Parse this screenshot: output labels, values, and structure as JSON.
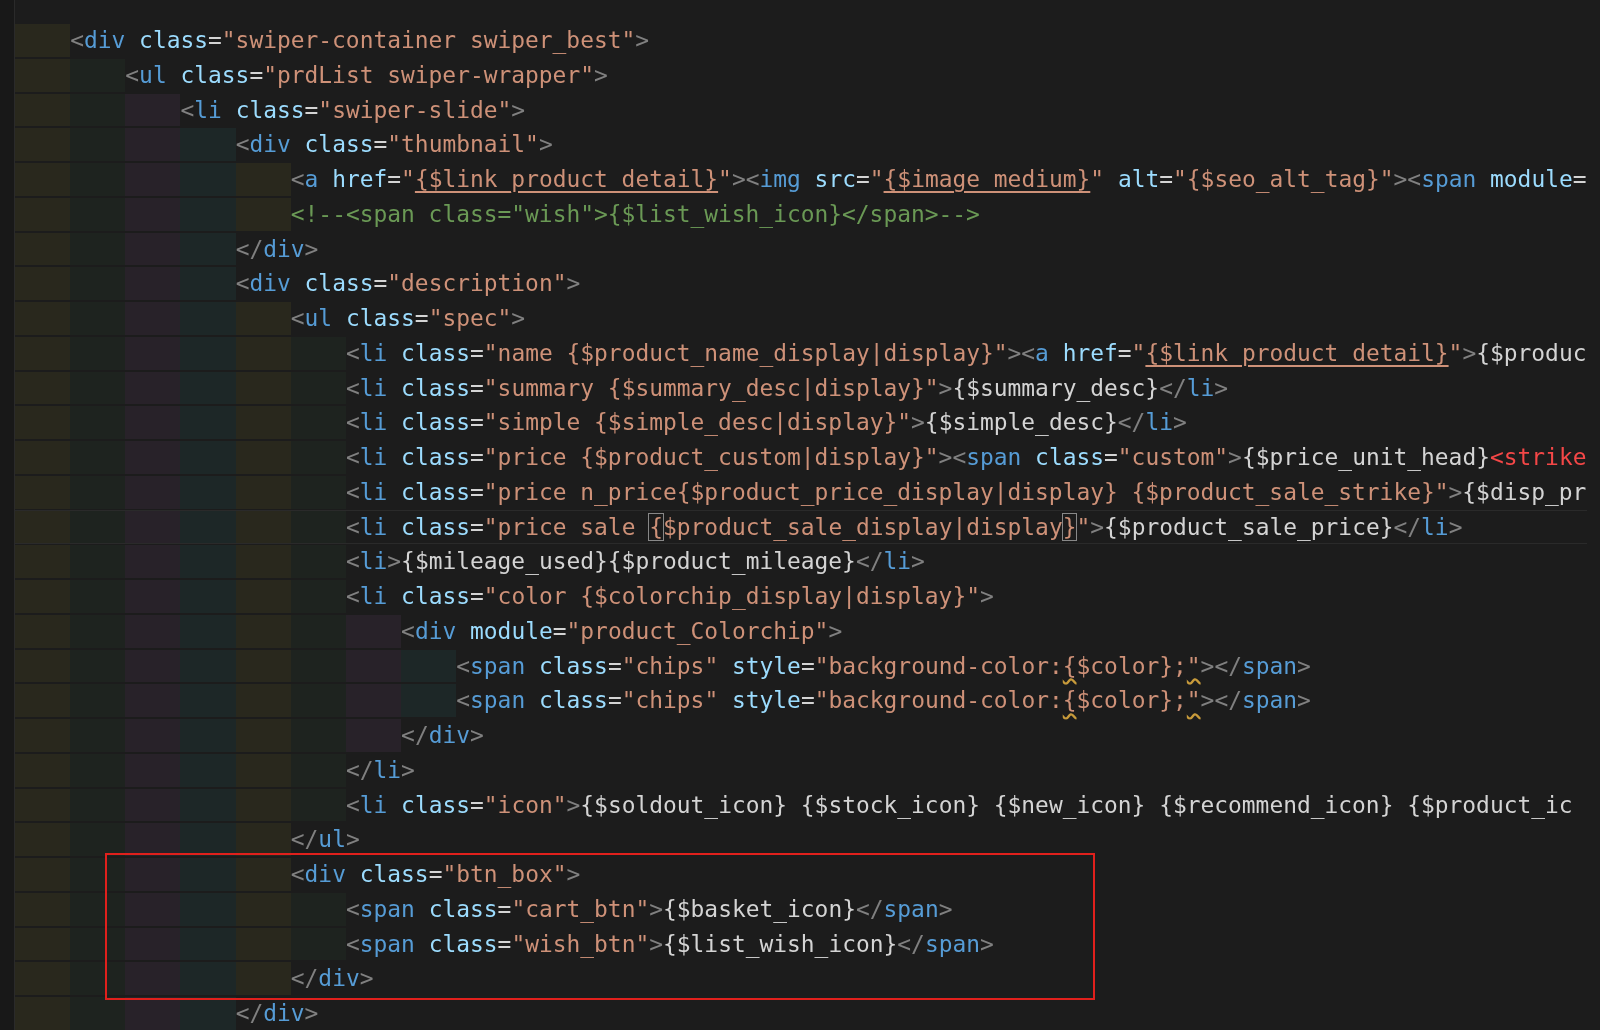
{
  "editor": {
    "lines": [
      {
        "boxed": false,
        "current": false,
        "tokens": [
          {
            "kind": "punct",
            "text": "    <"
          },
          {
            "kind": "tag",
            "text": "div"
          },
          {
            "kind": "attr",
            "text": " class"
          },
          {
            "kind": "text",
            "text": "="
          },
          {
            "kind": "string",
            "text": "\"swiper-container swiper_best\""
          },
          {
            "kind": "punct",
            "text": ">"
          }
        ]
      },
      {
        "boxed": false,
        "current": false,
        "tokens": [
          {
            "kind": "punct",
            "text": "        <"
          },
          {
            "kind": "tag",
            "text": "ul"
          },
          {
            "kind": "attr",
            "text": " class"
          },
          {
            "kind": "text",
            "text": "="
          },
          {
            "kind": "string",
            "text": "\"prdList swiper-wrapper\""
          },
          {
            "kind": "punct",
            "text": ">"
          }
        ]
      },
      {
        "boxed": false,
        "current": false,
        "tokens": [
          {
            "kind": "punct",
            "text": "            <"
          },
          {
            "kind": "tag",
            "text": "li"
          },
          {
            "kind": "attr",
            "text": " class"
          },
          {
            "kind": "text",
            "text": "="
          },
          {
            "kind": "string",
            "text": "\"swiper-slide\""
          },
          {
            "kind": "punct",
            "text": ">"
          }
        ]
      },
      {
        "boxed": false,
        "current": false,
        "tokens": [
          {
            "kind": "punct",
            "text": "                <"
          },
          {
            "kind": "tag",
            "text": "div"
          },
          {
            "kind": "attr",
            "text": " class"
          },
          {
            "kind": "text",
            "text": "="
          },
          {
            "kind": "string",
            "text": "\"thumbnail\""
          },
          {
            "kind": "punct",
            "text": ">"
          }
        ]
      },
      {
        "boxed": false,
        "current": false,
        "tokens": [
          {
            "kind": "punct",
            "text": "                    <"
          },
          {
            "kind": "tag",
            "text": "a"
          },
          {
            "kind": "attr",
            "text": " href"
          },
          {
            "kind": "text",
            "text": "="
          },
          {
            "kind": "string",
            "text": "\""
          },
          {
            "kind": "link",
            "text": "{$link_product_detail}"
          },
          {
            "kind": "string",
            "text": "\""
          },
          {
            "kind": "punct",
            "text": "><"
          },
          {
            "kind": "tag",
            "text": "img"
          },
          {
            "kind": "attr",
            "text": " src"
          },
          {
            "kind": "text",
            "text": "="
          },
          {
            "kind": "string",
            "text": "\""
          },
          {
            "kind": "link",
            "text": "{$image_medium}"
          },
          {
            "kind": "string",
            "text": "\""
          },
          {
            "kind": "attr",
            "text": " alt"
          },
          {
            "kind": "text",
            "text": "="
          },
          {
            "kind": "string",
            "text": "\"{$seo_alt_tag}\""
          },
          {
            "kind": "punct",
            "text": "><"
          },
          {
            "kind": "tag",
            "text": "span"
          },
          {
            "kind": "attr",
            "text": " module"
          },
          {
            "kind": "text",
            "text": "="
          }
        ]
      },
      {
        "boxed": false,
        "current": false,
        "tokens": [
          {
            "kind": "comment",
            "text": "                    <!--<span class=\"wish\">{$list_wish_icon}</span>-->"
          }
        ]
      },
      {
        "boxed": false,
        "current": false,
        "tokens": [
          {
            "kind": "punct",
            "text": "                </"
          },
          {
            "kind": "tag",
            "text": "div"
          },
          {
            "kind": "punct",
            "text": ">"
          }
        ]
      },
      {
        "boxed": false,
        "current": false,
        "tokens": [
          {
            "kind": "punct",
            "text": "                <"
          },
          {
            "kind": "tag",
            "text": "div"
          },
          {
            "kind": "attr",
            "text": " class"
          },
          {
            "kind": "text",
            "text": "="
          },
          {
            "kind": "string",
            "text": "\"description\""
          },
          {
            "kind": "punct",
            "text": ">"
          }
        ]
      },
      {
        "boxed": false,
        "current": false,
        "tokens": [
          {
            "kind": "punct",
            "text": "                    <"
          },
          {
            "kind": "tag",
            "text": "ul"
          },
          {
            "kind": "attr",
            "text": " class"
          },
          {
            "kind": "text",
            "text": "="
          },
          {
            "kind": "string",
            "text": "\"spec\""
          },
          {
            "kind": "punct",
            "text": ">"
          }
        ]
      },
      {
        "boxed": false,
        "current": false,
        "tokens": [
          {
            "kind": "punct",
            "text": "                        <"
          },
          {
            "kind": "tag",
            "text": "li"
          },
          {
            "kind": "attr",
            "text": " class"
          },
          {
            "kind": "text",
            "text": "="
          },
          {
            "kind": "string",
            "text": "\"name {$product_name_display|display}\""
          },
          {
            "kind": "punct",
            "text": "><"
          },
          {
            "kind": "tag",
            "text": "a"
          },
          {
            "kind": "attr",
            "text": " href"
          },
          {
            "kind": "text",
            "text": "="
          },
          {
            "kind": "string",
            "text": "\""
          },
          {
            "kind": "link",
            "text": "{$link_product_detail}"
          },
          {
            "kind": "string",
            "text": "\""
          },
          {
            "kind": "punct",
            "text": ">"
          },
          {
            "kind": "text",
            "text": "{$produc"
          }
        ]
      },
      {
        "boxed": false,
        "current": false,
        "tokens": [
          {
            "kind": "punct",
            "text": "                        <"
          },
          {
            "kind": "tag",
            "text": "li"
          },
          {
            "kind": "attr",
            "text": " class"
          },
          {
            "kind": "text",
            "text": "="
          },
          {
            "kind": "string",
            "text": "\"summary {$summary_desc|display}\""
          },
          {
            "kind": "punct",
            "text": ">"
          },
          {
            "kind": "text",
            "text": "{$summary_desc}"
          },
          {
            "kind": "punct",
            "text": "</"
          },
          {
            "kind": "tag",
            "text": "li"
          },
          {
            "kind": "punct",
            "text": ">"
          }
        ]
      },
      {
        "boxed": false,
        "current": false,
        "tokens": [
          {
            "kind": "punct",
            "text": "                        <"
          },
          {
            "kind": "tag",
            "text": "li"
          },
          {
            "kind": "attr",
            "text": " class"
          },
          {
            "kind": "text",
            "text": "="
          },
          {
            "kind": "string",
            "text": "\"simple {$simple_desc|display}\""
          },
          {
            "kind": "punct",
            "text": ">"
          },
          {
            "kind": "text",
            "text": "{$simple_desc}"
          },
          {
            "kind": "punct",
            "text": "</"
          },
          {
            "kind": "tag",
            "text": "li"
          },
          {
            "kind": "punct",
            "text": ">"
          }
        ]
      },
      {
        "boxed": false,
        "current": false,
        "tokens": [
          {
            "kind": "punct",
            "text": "                        <"
          },
          {
            "kind": "tag",
            "text": "li"
          },
          {
            "kind": "attr",
            "text": " class"
          },
          {
            "kind": "text",
            "text": "="
          },
          {
            "kind": "string",
            "text": "\"price {$product_custom|display}\""
          },
          {
            "kind": "punct",
            "text": "><"
          },
          {
            "kind": "tag",
            "text": "span"
          },
          {
            "kind": "attr",
            "text": " class"
          },
          {
            "kind": "text",
            "text": "="
          },
          {
            "kind": "string",
            "text": "\"custom\""
          },
          {
            "kind": "punct",
            "text": ">"
          },
          {
            "kind": "text",
            "text": "{$price_unit_head}"
          },
          {
            "kind": "deprecated",
            "text": "<strike"
          }
        ]
      },
      {
        "boxed": false,
        "current": false,
        "tokens": [
          {
            "kind": "punct",
            "text": "                        <"
          },
          {
            "kind": "tag",
            "text": "li"
          },
          {
            "kind": "attr",
            "text": " class"
          },
          {
            "kind": "text",
            "text": "="
          },
          {
            "kind": "string",
            "text": "\"price n_price{$product_price_display|display} {$product_sale_strike}\""
          },
          {
            "kind": "punct",
            "text": ">"
          },
          {
            "kind": "text",
            "text": "{$disp_pr"
          }
        ]
      },
      {
        "boxed": false,
        "current": true,
        "tokens": [
          {
            "kind": "punct",
            "text": "                        <"
          },
          {
            "kind": "tag",
            "text": "li"
          },
          {
            "kind": "attr",
            "text": " class"
          },
          {
            "kind": "text",
            "text": "="
          },
          {
            "kind": "string",
            "text": "\"price sale "
          },
          {
            "kind": "bracket",
            "text": "{"
          },
          {
            "kind": "string",
            "text": "$product_sale_display|display"
          },
          {
            "kind": "bracket",
            "text": "}"
          },
          {
            "kind": "string",
            "text": "\""
          },
          {
            "kind": "punct",
            "text": ">"
          },
          {
            "kind": "text",
            "text": "{$product_sale_price}"
          },
          {
            "kind": "punct",
            "text": "</"
          },
          {
            "kind": "tag",
            "text": "li"
          },
          {
            "kind": "punct",
            "text": ">"
          }
        ]
      },
      {
        "boxed": false,
        "current": false,
        "tokens": [
          {
            "kind": "punct",
            "text": "                        <"
          },
          {
            "kind": "tag",
            "text": "li"
          },
          {
            "kind": "punct",
            "text": ">"
          },
          {
            "kind": "text",
            "text": "{$mileage_used}{$product_mileage}"
          },
          {
            "kind": "punct",
            "text": "</"
          },
          {
            "kind": "tag",
            "text": "li"
          },
          {
            "kind": "punct",
            "text": ">"
          }
        ]
      },
      {
        "boxed": false,
        "current": false,
        "tokens": [
          {
            "kind": "punct",
            "text": "                        <"
          },
          {
            "kind": "tag",
            "text": "li"
          },
          {
            "kind": "attr",
            "text": " class"
          },
          {
            "kind": "text",
            "text": "="
          },
          {
            "kind": "string",
            "text": "\"color {$colorchip_display|display}\""
          },
          {
            "kind": "punct",
            "text": ">"
          }
        ]
      },
      {
        "boxed": false,
        "current": false,
        "tokens": [
          {
            "kind": "punct",
            "text": "                            <"
          },
          {
            "kind": "tag",
            "text": "div"
          },
          {
            "kind": "attr",
            "text": " module"
          },
          {
            "kind": "text",
            "text": "="
          },
          {
            "kind": "string",
            "text": "\"product_Colorchip\""
          },
          {
            "kind": "punct",
            "text": ">"
          }
        ]
      },
      {
        "boxed": false,
        "current": false,
        "tokens": [
          {
            "kind": "punct",
            "text": "                                <"
          },
          {
            "kind": "tag",
            "text": "span"
          },
          {
            "kind": "attr",
            "text": " class"
          },
          {
            "kind": "text",
            "text": "="
          },
          {
            "kind": "string",
            "text": "\"chips\""
          },
          {
            "kind": "attr",
            "text": " style"
          },
          {
            "kind": "text",
            "text": "="
          },
          {
            "kind": "string",
            "text": "\"background-color:"
          },
          {
            "kind": "warning",
            "text": "{"
          },
          {
            "kind": "string",
            "text": "$color};"
          },
          {
            "kind": "warning",
            "text": "\""
          },
          {
            "kind": "punct",
            "text": "></"
          },
          {
            "kind": "tag",
            "text": "span"
          },
          {
            "kind": "punct",
            "text": ">"
          }
        ]
      },
      {
        "boxed": false,
        "current": false,
        "tokens": [
          {
            "kind": "punct",
            "text": "                                <"
          },
          {
            "kind": "tag",
            "text": "span"
          },
          {
            "kind": "attr",
            "text": " class"
          },
          {
            "kind": "text",
            "text": "="
          },
          {
            "kind": "string",
            "text": "\"chips\""
          },
          {
            "kind": "attr",
            "text": " style"
          },
          {
            "kind": "text",
            "text": "="
          },
          {
            "kind": "string",
            "text": "\"background-color:"
          },
          {
            "kind": "warning",
            "text": "{"
          },
          {
            "kind": "string",
            "text": "$color};"
          },
          {
            "kind": "warning",
            "text": "\""
          },
          {
            "kind": "punct",
            "text": "></"
          },
          {
            "kind": "tag",
            "text": "span"
          },
          {
            "kind": "punct",
            "text": ">"
          }
        ]
      },
      {
        "boxed": false,
        "current": false,
        "tokens": [
          {
            "kind": "punct",
            "text": "                            </"
          },
          {
            "kind": "tag",
            "text": "div"
          },
          {
            "kind": "punct",
            "text": ">"
          }
        ]
      },
      {
        "boxed": false,
        "current": false,
        "tokens": [
          {
            "kind": "punct",
            "text": "                        </"
          },
          {
            "kind": "tag",
            "text": "li"
          },
          {
            "kind": "punct",
            "text": ">"
          }
        ]
      },
      {
        "boxed": false,
        "current": false,
        "tokens": [
          {
            "kind": "punct",
            "text": "                        <"
          },
          {
            "kind": "tag",
            "text": "li"
          },
          {
            "kind": "attr",
            "text": " class"
          },
          {
            "kind": "text",
            "text": "="
          },
          {
            "kind": "string",
            "text": "\"icon\""
          },
          {
            "kind": "punct",
            "text": ">"
          },
          {
            "kind": "text",
            "text": "{$soldout_icon} {$stock_icon} {$new_icon} {$recommend_icon} {$product_ic"
          }
        ]
      },
      {
        "boxed": false,
        "current": false,
        "tokens": [
          {
            "kind": "punct",
            "text": "                    </"
          },
          {
            "kind": "tag",
            "text": "ul"
          },
          {
            "kind": "punct",
            "text": ">"
          }
        ]
      },
      {
        "boxed": true,
        "current": false,
        "tokens": [
          {
            "kind": "punct",
            "text": "                    <"
          },
          {
            "kind": "tag",
            "text": "div"
          },
          {
            "kind": "attr",
            "text": " class"
          },
          {
            "kind": "text",
            "text": "="
          },
          {
            "kind": "string",
            "text": "\"btn_box\""
          },
          {
            "kind": "punct",
            "text": ">"
          }
        ]
      },
      {
        "boxed": true,
        "current": false,
        "tokens": [
          {
            "kind": "punct",
            "text": "                        <"
          },
          {
            "kind": "tag",
            "text": "span"
          },
          {
            "kind": "attr",
            "text": " class"
          },
          {
            "kind": "text",
            "text": "="
          },
          {
            "kind": "string",
            "text": "\"cart_btn\""
          },
          {
            "kind": "punct",
            "text": ">"
          },
          {
            "kind": "text",
            "text": "{$basket_icon}"
          },
          {
            "kind": "punct",
            "text": "</"
          },
          {
            "kind": "tag",
            "text": "span"
          },
          {
            "kind": "punct",
            "text": ">"
          }
        ]
      },
      {
        "boxed": true,
        "current": false,
        "tokens": [
          {
            "kind": "punct",
            "text": "                        <"
          },
          {
            "kind": "tag",
            "text": "span"
          },
          {
            "kind": "attr",
            "text": " class"
          },
          {
            "kind": "text",
            "text": "="
          },
          {
            "kind": "string",
            "text": "\"wish_btn\""
          },
          {
            "kind": "punct",
            "text": ">"
          },
          {
            "kind": "text",
            "text": "{$list_wish_icon}"
          },
          {
            "kind": "punct",
            "text": "</"
          },
          {
            "kind": "tag",
            "text": "span"
          },
          {
            "kind": "punct",
            "text": ">"
          }
        ]
      },
      {
        "boxed": true,
        "current": false,
        "tokens": [
          {
            "kind": "punct",
            "text": "                    </"
          },
          {
            "kind": "tag",
            "text": "div"
          },
          {
            "kind": "punct",
            "text": ">"
          }
        ]
      },
      {
        "boxed": false,
        "current": false,
        "tokens": [
          {
            "kind": "punct",
            "text": "                </"
          },
          {
            "kind": "tag",
            "text": "div"
          },
          {
            "kind": "punct",
            "text": ">"
          }
        ]
      }
    ]
  }
}
